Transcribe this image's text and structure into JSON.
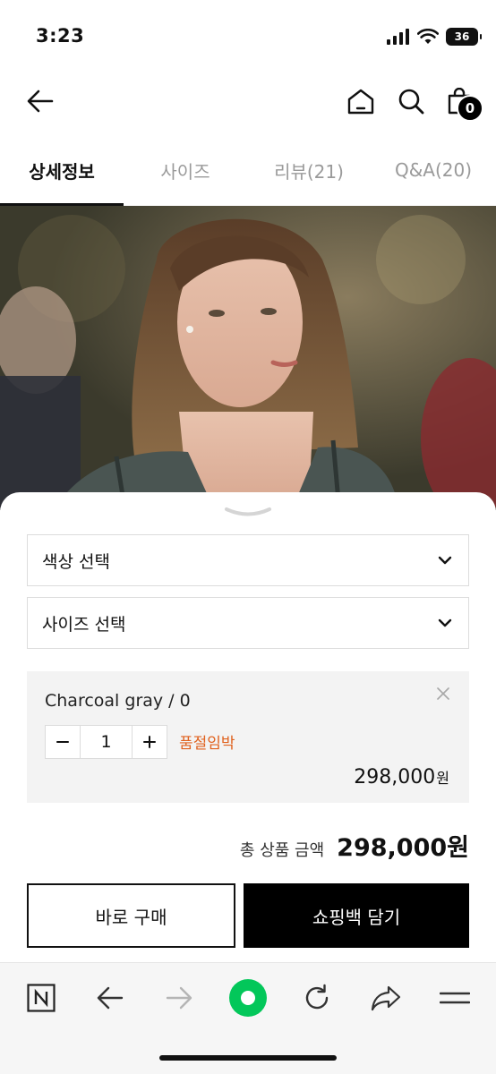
{
  "status_bar": {
    "time": "3:23",
    "battery": "36"
  },
  "header": {
    "bag_count": "0"
  },
  "tabs": [
    {
      "label": "상세정보"
    },
    {
      "label": "사이즈"
    },
    {
      "label": "리뷰(21)"
    },
    {
      "label": "Q&A(20)"
    }
  ],
  "options": {
    "color_placeholder": "색상 선택",
    "size_placeholder": "사이즈 선택"
  },
  "selected_item": {
    "name": "Charcoal gray / 0",
    "quantity": "1",
    "stock_notice": "품절임박",
    "price": "298,000",
    "currency": "원"
  },
  "total": {
    "label": "총 상품 금액",
    "value": "298,000원"
  },
  "actions": {
    "buy_now": "바로 구매",
    "add_to_cart": "쇼핑백 담기"
  },
  "colors": {
    "accent": "#e0621f",
    "primary": "#000000",
    "browser_brand": "#03c75a"
  },
  "icons": [
    "back-arrow-icon",
    "home-icon",
    "search-icon",
    "shopping-bag-icon",
    "chevron-down-icon",
    "close-icon",
    "minus-icon",
    "plus-icon",
    "naver-n-icon",
    "refresh-icon",
    "share-icon",
    "menu-icon"
  ]
}
